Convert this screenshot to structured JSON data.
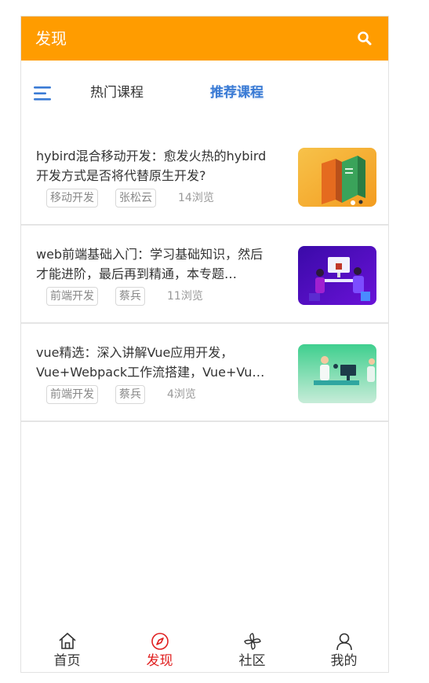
{
  "header": {
    "title": "发现",
    "search_icon": "search-icon",
    "color": "#ff9c00"
  },
  "tabs": {
    "menu_icon": "menu-icon",
    "hot": "热门课程",
    "recommended": "推荐课程",
    "active_color": "#3a7bd5"
  },
  "courses": [
    {
      "title": "hybird混合移动开发：愈发火热的hybird开发方式是否将代替原生开发?",
      "tag": "移动开发",
      "author": "张松云",
      "views": "14浏览",
      "thumb": "books-illustration"
    },
    {
      "title": "web前端基础入门：学习基础知识，然后才能进阶，最后再到精通，本专题…",
      "tag": "前端开发",
      "author": "蔡兵",
      "views": "11浏览",
      "thumb": "coders-at-desk-illustration"
    },
    {
      "title": "vue精选：深入讲解Vue应用开发，Vue+Webpack工作流搭建，Vue+Vu…",
      "tag": "前端开发",
      "author": "蔡兵",
      "views": "4浏览",
      "thumb": "meeting-illustration"
    }
  ],
  "nav": [
    {
      "label": "首页",
      "icon": "home-icon"
    },
    {
      "label": "发现",
      "icon": "compass-icon",
      "active": true
    },
    {
      "label": "社区",
      "icon": "pinwheel-icon"
    },
    {
      "label": "我的",
      "icon": "user-icon"
    }
  ],
  "colors": {
    "active_nav": "#e02020"
  }
}
